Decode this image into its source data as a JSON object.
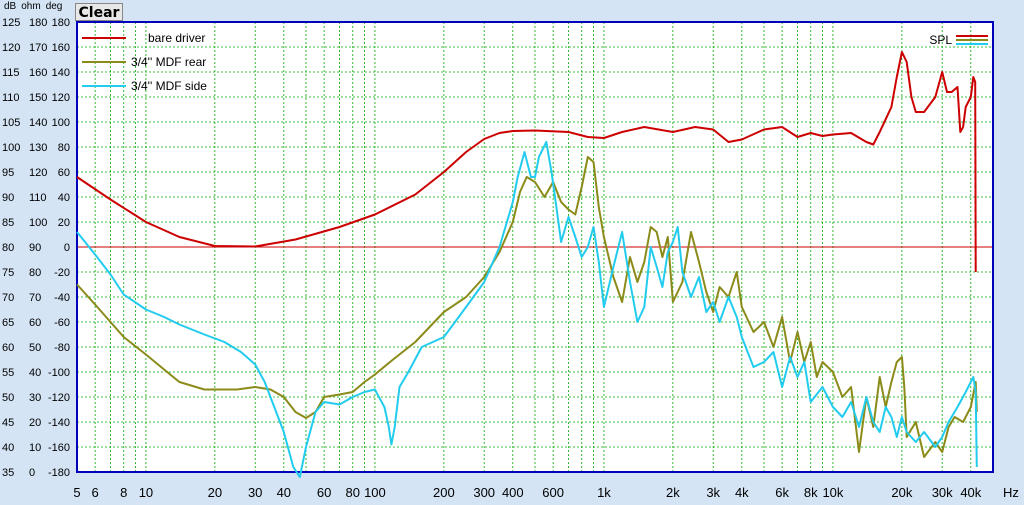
{
  "toolbar": {
    "clear_label": "Clear"
  },
  "header_units": [
    "dB",
    "ohm",
    "deg"
  ],
  "chart_data": {
    "type": "line",
    "xscale": "log",
    "xlim": [
      5,
      50000
    ],
    "x_tick_labels": [
      {
        "v": 5,
        "t": "5"
      },
      {
        "v": 6,
        "t": "6"
      },
      {
        "v": 8,
        "t": "8"
      },
      {
        "v": 10,
        "t": "10"
      },
      {
        "v": 20,
        "t": "20"
      },
      {
        "v": 30,
        "t": "30"
      },
      {
        "v": 40,
        "t": "40"
      },
      {
        "v": 60,
        "t": "60"
      },
      {
        "v": 80,
        "t": "80"
      },
      {
        "v": 100,
        "t": "100"
      },
      {
        "v": 200,
        "t": "200"
      },
      {
        "v": 300,
        "t": "300"
      },
      {
        "v": 400,
        "t": "400"
      },
      {
        "v": 600,
        "t": "600"
      },
      {
        "v": 1000,
        "t": "1k"
      },
      {
        "v": 2000,
        "t": "2k"
      },
      {
        "v": 3000,
        "t": "3k"
      },
      {
        "v": 4000,
        "t": "4k"
      },
      {
        "v": 6000,
        "t": "6k"
      },
      {
        "v": 8000,
        "t": "8k"
      },
      {
        "v": 10000,
        "t": "10k"
      },
      {
        "v": 20000,
        "t": "20k"
      },
      {
        "v": 30000,
        "t": "30k"
      },
      {
        "v": 40000,
        "t": "40k"
      }
    ],
    "x_unit": "Hz",
    "ylim_db": [
      35,
      125
    ],
    "y_ticks_db": [
      "125",
      "120",
      "115",
      "110",
      "105",
      "100",
      "95",
      "90",
      "85",
      "80",
      "75",
      "70",
      "65",
      "60",
      "55",
      "50",
      "45",
      "40",
      "35"
    ],
    "y_ticks_ohm": [
      "180",
      "170",
      "160",
      "150",
      "140",
      "130",
      "120",
      "110",
      "100",
      "90",
      "80",
      "70",
      "60",
      "50",
      "40",
      "30",
      "20",
      "10",
      "0"
    ],
    "y_ticks_deg": [
      "180",
      "160",
      "140",
      "120",
      "100",
      "80",
      "60",
      "40",
      "20",
      "0",
      "-20",
      "-40",
      "-60",
      "-80",
      "-100",
      "-120",
      "-140",
      "-160",
      "-180"
    ],
    "reference_line_db": 80,
    "legend_right": "SPL",
    "colors": {
      "bare_driver": "#cc0000",
      "mdf_rear": "#8b8b1a",
      "mdf_side": "#22ccee",
      "grid": "#00aa00",
      "ref": "#cc0000",
      "frame": "#0000bb"
    },
    "series": [
      {
        "name": "bare driver",
        "color": "#cc0000",
        "points": [
          [
            5,
            94
          ],
          [
            7,
            89.5
          ],
          [
            10,
            85
          ],
          [
            14,
            82
          ],
          [
            20,
            80.2
          ],
          [
            30,
            80.1
          ],
          [
            45,
            81.5
          ],
          [
            70,
            84
          ],
          [
            100,
            86.5
          ],
          [
            150,
            90.5
          ],
          [
            200,
            95
          ],
          [
            250,
            99
          ],
          [
            300,
            101.6
          ],
          [
            350,
            102.8
          ],
          [
            400,
            103.2
          ],
          [
            500,
            103.3
          ],
          [
            700,
            103
          ],
          [
            850,
            102
          ],
          [
            1000,
            101.8
          ],
          [
            1200,
            103
          ],
          [
            1500,
            104
          ],
          [
            2000,
            103
          ],
          [
            2500,
            104
          ],
          [
            3000,
            103.5
          ],
          [
            3500,
            101
          ],
          [
            4000,
            101.5
          ],
          [
            5000,
            103.5
          ],
          [
            6000,
            104
          ],
          [
            7000,
            102
          ],
          [
            8000,
            102.8
          ],
          [
            9000,
            102.2
          ],
          [
            10000,
            102.5
          ],
          [
            12000,
            102.8
          ],
          [
            14000,
            101
          ],
          [
            15000,
            100.5
          ],
          [
            16000,
            103
          ],
          [
            18000,
            108
          ],
          [
            19000,
            114
          ],
          [
            20000,
            119
          ],
          [
            21000,
            117
          ],
          [
            22000,
            110
          ],
          [
            23000,
            107
          ],
          [
            25000,
            107
          ],
          [
            28000,
            110
          ],
          [
            30000,
            115
          ],
          [
            31500,
            111
          ],
          [
            33000,
            111
          ],
          [
            35000,
            112
          ],
          [
            36000,
            103
          ],
          [
            37000,
            104
          ],
          [
            38000,
            108
          ],
          [
            40000,
            110
          ],
          [
            41000,
            114
          ],
          [
            41800,
            113
          ],
          [
            42000,
            75
          ]
        ]
      },
      {
        "name": "3/4'' MDF rear",
        "color": "#8b8b1a",
        "points": [
          [
            5,
            72.5
          ],
          [
            6,
            68.5
          ],
          [
            7,
            65
          ],
          [
            8,
            62
          ],
          [
            10,
            58.5
          ],
          [
            12,
            55.5
          ],
          [
            14,
            53
          ],
          [
            18,
            51.5
          ],
          [
            25,
            51.5
          ],
          [
            30,
            52
          ],
          [
            35,
            51.5
          ],
          [
            40,
            50
          ],
          [
            45,
            47
          ],
          [
            50,
            45.8
          ],
          [
            55,
            47
          ],
          [
            60,
            50
          ],
          [
            70,
            50.5
          ],
          [
            80,
            51
          ],
          [
            90,
            53
          ],
          [
            100,
            54.5
          ],
          [
            120,
            57.5
          ],
          [
            150,
            61
          ],
          [
            200,
            67
          ],
          [
            250,
            70
          ],
          [
            300,
            74
          ],
          [
            350,
            79
          ],
          [
            400,
            85
          ],
          [
            430,
            91
          ],
          [
            460,
            94
          ],
          [
            500,
            93
          ],
          [
            550,
            90
          ],
          [
            600,
            93
          ],
          [
            650,
            89
          ],
          [
            700,
            87.5
          ],
          [
            750,
            86.5
          ],
          [
            800,
            92
          ],
          [
            850,
            98
          ],
          [
            900,
            97
          ],
          [
            950,
            88
          ],
          [
            1000,
            82
          ],
          [
            1100,
            74
          ],
          [
            1200,
            69
          ],
          [
            1300,
            78
          ],
          [
            1400,
            73
          ],
          [
            1500,
            77
          ],
          [
            1600,
            84
          ],
          [
            1700,
            83
          ],
          [
            1800,
            78
          ],
          [
            1900,
            82
          ],
          [
            2000,
            69
          ],
          [
            2200,
            73
          ],
          [
            2400,
            83
          ],
          [
            2600,
            77
          ],
          [
            2800,
            71
          ],
          [
            3000,
            67
          ],
          [
            3200,
            72
          ],
          [
            3500,
            70
          ],
          [
            3800,
            75
          ],
          [
            4000,
            68
          ],
          [
            4500,
            63
          ],
          [
            5000,
            65
          ],
          [
            5500,
            60
          ],
          [
            6000,
            66
          ],
          [
            6500,
            57
          ],
          [
            7000,
            63
          ],
          [
            7500,
            57
          ],
          [
            8000,
            61
          ],
          [
            8500,
            54
          ],
          [
            9000,
            57
          ],
          [
            10000,
            55
          ],
          [
            11000,
            50
          ],
          [
            12000,
            52
          ],
          [
            13000,
            39
          ],
          [
            14000,
            50
          ],
          [
            15000,
            44
          ],
          [
            16000,
            54
          ],
          [
            17000,
            48
          ],
          [
            18000,
            53
          ],
          [
            19000,
            57
          ],
          [
            20000,
            58
          ],
          [
            20500,
            52
          ],
          [
            21000,
            42
          ],
          [
            23000,
            45
          ],
          [
            25000,
            38
          ],
          [
            28000,
            41
          ],
          [
            30000,
            39
          ],
          [
            32000,
            44
          ],
          [
            34000,
            46
          ],
          [
            37000,
            45
          ],
          [
            40000,
            48
          ],
          [
            42000,
            53
          ],
          [
            42500,
            47
          ]
        ]
      },
      {
        "name": "3/4'' MDF side",
        "color": "#22ccee",
        "points": [
          [
            5,
            83
          ],
          [
            6,
            78.5
          ],
          [
            7,
            74.5
          ],
          [
            8,
            70.5
          ],
          [
            10,
            67.5
          ],
          [
            12,
            66
          ],
          [
            14,
            64.5
          ],
          [
            18,
            62.5
          ],
          [
            22,
            61
          ],
          [
            26,
            59
          ],
          [
            30,
            56.5
          ],
          [
            33,
            53
          ],
          [
            36,
            48.5
          ],
          [
            40,
            43
          ],
          [
            44,
            36
          ],
          [
            47,
            34
          ],
          [
            50,
            40
          ],
          [
            55,
            47
          ],
          [
            60,
            49
          ],
          [
            70,
            48.5
          ],
          [
            80,
            50
          ],
          [
            90,
            51
          ],
          [
            100,
            51.5
          ],
          [
            110,
            48
          ],
          [
            115,
            44
          ],
          [
            118,
            40.5
          ],
          [
            122,
            44
          ],
          [
            128,
            52
          ],
          [
            140,
            55
          ],
          [
            160,
            60
          ],
          [
            200,
            62
          ],
          [
            250,
            68
          ],
          [
            300,
            73
          ],
          [
            350,
            80
          ],
          [
            400,
            89
          ],
          [
            420,
            94
          ],
          [
            450,
            99
          ],
          [
            480,
            94
          ],
          [
            500,
            94
          ],
          [
            520,
            98
          ],
          [
            560,
            101
          ],
          [
            590,
            95
          ],
          [
            620,
            88
          ],
          [
            650,
            81
          ],
          [
            700,
            86
          ],
          [
            750,
            82
          ],
          [
            800,
            78
          ],
          [
            850,
            80
          ],
          [
            900,
            84
          ],
          [
            950,
            77
          ],
          [
            1000,
            68
          ],
          [
            1100,
            76
          ],
          [
            1200,
            83
          ],
          [
            1300,
            73
          ],
          [
            1400,
            65
          ],
          [
            1500,
            68
          ],
          [
            1600,
            80
          ],
          [
            1700,
            76
          ],
          [
            1800,
            72
          ],
          [
            1900,
            79
          ],
          [
            2000,
            81
          ],
          [
            2100,
            84
          ],
          [
            2200,
            75
          ],
          [
            2400,
            70
          ],
          [
            2600,
            74
          ],
          [
            2800,
            67
          ],
          [
            3000,
            69
          ],
          [
            3200,
            65
          ],
          [
            3500,
            70
          ],
          [
            3800,
            66
          ],
          [
            4000,
            62
          ],
          [
            4500,
            56
          ],
          [
            5000,
            57
          ],
          [
            5500,
            59
          ],
          [
            6000,
            52
          ],
          [
            6500,
            58
          ],
          [
            7000,
            54
          ],
          [
            7500,
            57
          ],
          [
            8000,
            49
          ],
          [
            9000,
            52
          ],
          [
            10000,
            48
          ],
          [
            11000,
            46
          ],
          [
            12000,
            49
          ],
          [
            13000,
            44
          ],
          [
            14000,
            50
          ],
          [
            15000,
            45
          ],
          [
            16000,
            43
          ],
          [
            17000,
            48
          ],
          [
            18000,
            46
          ],
          [
            19000,
            42
          ],
          [
            20000,
            46
          ],
          [
            21000,
            43
          ],
          [
            23000,
            41
          ],
          [
            25000,
            43
          ],
          [
            28000,
            40
          ],
          [
            30000,
            42
          ],
          [
            32000,
            45
          ],
          [
            35000,
            48
          ],
          [
            38000,
            51
          ],
          [
            40000,
            53
          ],
          [
            41000,
            54
          ],
          [
            42000,
            51
          ],
          [
            42500,
            36
          ]
        ]
      }
    ]
  }
}
